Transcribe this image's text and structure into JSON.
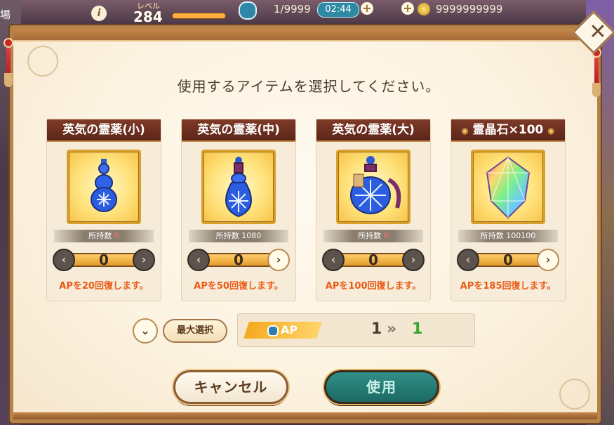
{
  "hud": {
    "left_text": "場",
    "level_label": "レベル",
    "level_value": "284",
    "ap_text": "1/9999",
    "ap_timer": "02:44",
    "coins": "9999999999",
    "info_label": "i",
    "plus_label": "+"
  },
  "dialog": {
    "prompt": "使用するアイテムを選択してください。",
    "close_label": "✕"
  },
  "items": [
    {
      "name": "英気の霊薬(小)",
      "owned_label": "所持数",
      "owned_value": "0",
      "quantity": "0",
      "recover_text": "APを20回復します。",
      "plus_enabled": false,
      "icon": "small-potion-icon"
    },
    {
      "name": "英気の霊薬(中)",
      "owned_label": "所持数",
      "owned_value": "1080",
      "quantity": "0",
      "recover_text": "APを50回復します。",
      "plus_enabled": true,
      "icon": "medium-potion-icon"
    },
    {
      "name": "英気の霊薬(大)",
      "owned_label": "所持数",
      "owned_value": "0",
      "quantity": "0",
      "recover_text": "APを100回復します。",
      "plus_enabled": false,
      "icon": "large-potion-icon"
    },
    {
      "name": "霊晶石×100",
      "owned_label": "所持数",
      "owned_value": "100100",
      "quantity": "0",
      "recover_text": "APを185回復します。",
      "plus_enabled": true,
      "icon": "crystal-icon"
    }
  ],
  "controls": {
    "max_select_label": "最大選択",
    "ap_label": "AP",
    "ap_from": "1",
    "ap_to": "1",
    "cancel_label": "キャンセル",
    "use_label": "使用",
    "minus_glyph": "‹",
    "plus_glyph": "›",
    "down_glyph": "⌄",
    "arrow_glyph": "»"
  }
}
